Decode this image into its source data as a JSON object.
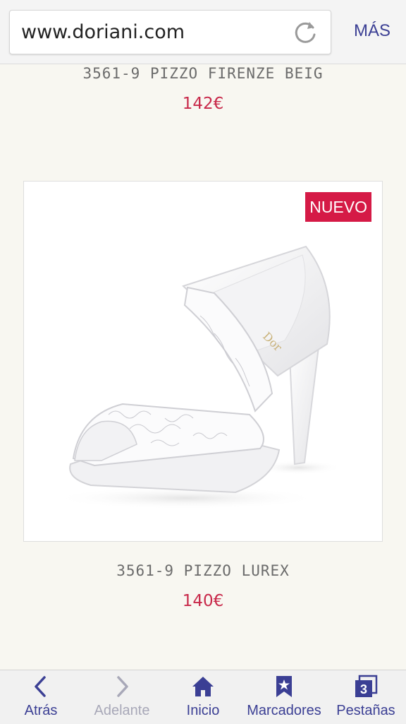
{
  "browser": {
    "url": "www.doriani.com",
    "more_label": "MÁS",
    "reload_icon": "reload-icon"
  },
  "products": [
    {
      "name": "3561-9 PIZZO FIRENZE BEIG",
      "price": "142€"
    },
    {
      "name": "3561-9 PIZZO LUREX",
      "price": "140€",
      "badge": "NUEVO",
      "brand_mark": "Dor"
    }
  ],
  "colors": {
    "accent": "#3b3f94",
    "price": "#c8294a",
    "badge": "#d51a46",
    "background": "#f8f7f1"
  },
  "nav": {
    "back": {
      "label": "Atrás",
      "icon": "chevron-left-icon"
    },
    "forward": {
      "label": "Adelante",
      "icon": "chevron-right-icon",
      "disabled": true
    },
    "home": {
      "label": "Inicio",
      "icon": "home-icon"
    },
    "bookmarks": {
      "label": "Marcadores",
      "icon": "bookmark-icon"
    },
    "tabs": {
      "label": "Pestañas",
      "icon": "tabs-icon",
      "count": "3"
    }
  }
}
